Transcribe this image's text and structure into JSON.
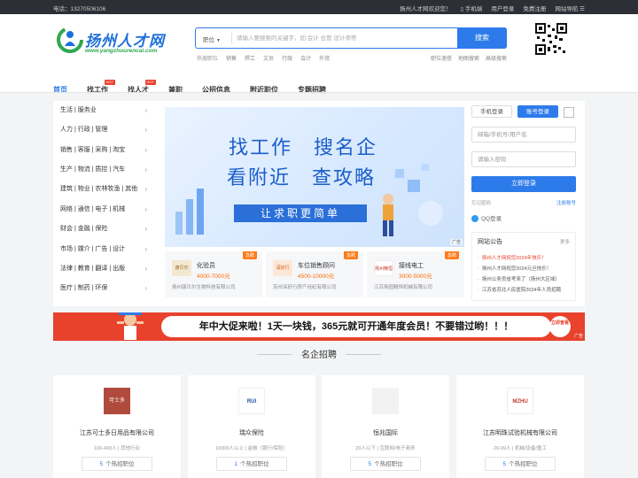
{
  "topbar": {
    "phone": "电话：13270506106",
    "welcome": "扬州人才网欢迎您！",
    "links": [
      "手机端",
      "用户登录",
      "免费注册",
      "网站导航"
    ]
  },
  "logo": {
    "cn": "扬州人才网",
    "en": "www.yangzhourencai.com"
  },
  "search": {
    "type": "职位",
    "placeholder": "请输入要搜索的关键字，如:会计 仓管 设计师等",
    "button": "搜索"
  },
  "hot": {
    "label": "热搜职位",
    "items": [
      "销售",
      "焊工",
      "文员",
      "行政",
      "会计",
      "外贸"
    ],
    "right": [
      "职位速搭",
      "地图搜索",
      "高级搜索"
    ]
  },
  "nav": {
    "items": [
      "首页",
      "找工作",
      "找人才",
      "兼职",
      "公招信息",
      "附近职位",
      "专题招聘"
    ],
    "hot_label": "HOT"
  },
  "categories": [
    "生活 | 服务业",
    "人力 | 行政 | 管理",
    "销售 | 客服 | 采购 | 淘宝",
    "生产 | 物流 | 质控 | 汽车",
    "建筑 | 物业 | 农林牧渔 | 其他",
    "网络 | 通信 | 电子 | 机械",
    "财会 | 金融 | 保险",
    "市场 | 媒介 | 广告 | 设计",
    "法律 | 教育 | 翻译 | 出版",
    "医疗 | 制药 | 环保"
  ],
  "banner": {
    "line1": "找工作　搜名企",
    "line2": "看附近　查攻略",
    "slogan": "让求职更简单",
    "ad": "广告"
  },
  "jobs": [
    {
      "logo": "康贝尔",
      "title": "化验员",
      "salary": "4000-7000元",
      "company": "扬州康贝尔生物科技有限公司",
      "tag": "急聘"
    },
    {
      "logo": "深好行",
      "title": "车位销售顾问",
      "salary": "4500-10000元",
      "company": "苏州深好行房产经纪有限公司",
      "tag": "急聘"
    },
    {
      "logo": "扬州精恒",
      "title": "接线电工",
      "salary": "3000-5000元",
      "company": "江苏扬园精恒机械有限公司",
      "tag": "急聘"
    }
  ],
  "login": {
    "tab_mobile": "手机登录",
    "tab_account": "账号登录",
    "username_placeholder": "邮箱/手机号/用户名",
    "password_placeholder": "请输入密码",
    "submit": "立即登录",
    "forgot": "忘记密码",
    "register": "注册账号",
    "qq": "QQ登录"
  },
  "notice": {
    "title": "网站公告",
    "more": "更多",
    "items": [
      "扬州人才网祝您2024年快乐！",
      "扬州人才网祝您2024元旦快乐！",
      "扬州公务员省考来了（扬州大区域）",
      "江苏省苏北人民医院2024年人员招聘"
    ]
  },
  "adbar": {
    "text": "年中大促来啦！1天一块钱，365元就可开通年度会员！不要错过哟！！！",
    "pill": "立即查看",
    "ad": "广告"
  },
  "section_title": "名企招聘",
  "companies": [
    {
      "logo": "可士多",
      "name": "江苏可士多日用品有限公司",
      "info": "100-499人 | 其他行业",
      "count": "5",
      "count_label": "个热招职位"
    },
    {
      "logo": "RUI",
      "name": "瑞众保险",
      "info": "10000人以上 | 金融（银行/保险）",
      "count": "1",
      "count_label": "个热招职位"
    },
    {
      "logo": "",
      "name": "恒兆国际",
      "info": "20人以下 | 互联网/电子商务",
      "count": "5",
      "count_label": "个热招职位"
    },
    {
      "logo": "MZHU",
      "name": "江苏明珠试验机械有限公司",
      "info": "20-99人 | 机械/设备/重工",
      "count": "5",
      "count_label": "个热招职位"
    }
  ],
  "colors": {
    "brand": "#2d7bea",
    "accent": "#e8412c",
    "salary": "#ff6a00"
  }
}
